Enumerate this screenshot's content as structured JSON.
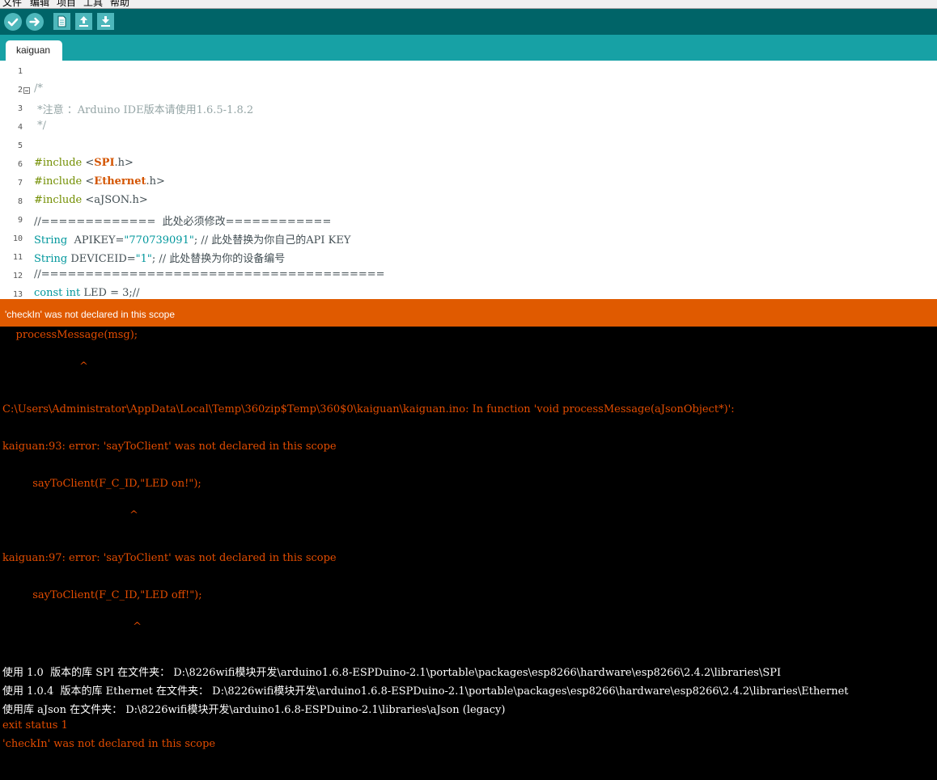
{
  "menubar": {
    "items": [
      "文件",
      "编辑",
      "项目",
      "工具",
      "帮助"
    ]
  },
  "toolbar": {
    "buttons": [
      "verify-icon",
      "upload-icon",
      "new-icon",
      "open-icon",
      "save-icon"
    ]
  },
  "tab": {
    "label": "kaiguan"
  },
  "editor": {
    "line_numbers": [
      "1",
      "2",
      "3",
      "4",
      "5",
      "6",
      "7",
      "8",
      "9",
      "10",
      "11",
      "12",
      "13"
    ],
    "lines": {
      "l2": "/*",
      "l3": " *注意 ：Arduino IDE版本请使用1.6.5-1.8.2",
      "l4": " */",
      "l6_pre": "#include ",
      "l6_a": "<",
      "l6_lib": "SPI",
      "l6_b": ".h>",
      "l7_pre": "#include ",
      "l7_a": "<",
      "l7_lib": "Ethernet",
      "l7_b": ".h>",
      "l8_pre": "#include ",
      "l8_rest": "<aJSON.h>",
      "l9": "//=============  此处必须修改============",
      "l10_type": "String",
      "l10_a": "  APIKEY=",
      "l10_str": "\"770739091\"",
      "l10_b": "; // 此处替换为你自己的API KEY",
      "l11_type": "String",
      "l11_a": " DEVICEID=",
      "l11_str": "\"1\"",
      "l11_b": "; // 此处替换为你的设备编号",
      "l12": "//=======================================",
      "l13_type": "const int",
      "l13_rest": " LED = 3;//"
    }
  },
  "status": {
    "message": "'checkIn' was not declared in this scope"
  },
  "console": {
    "lines": [
      "    processMessage(msg);",
      "                       ^",
      "C:\\Users\\Administrator\\AppData\\Local\\Temp\\360zip$Temp\\360$0\\kaiguan\\kaiguan.ino: In function 'void processMessage(aJsonObject*)':",
      "kaiguan:93: error: 'sayToClient' was not declared in this scope",
      "         sayToClient(F_C_ID,\"LED on!\");",
      "                                      ^",
      "kaiguan:97: error: 'sayToClient' was not declared in this scope",
      "         sayToClient(F_C_ID,\"LED off!\");",
      "                                       ^",
      "使用 1.0  版本的库 SPI 在文件夹： D:\\8226wifi模块开发\\arduino1.6.8-ESPDuino-2.1\\portable\\packages\\esp8266\\hardware\\esp8266\\2.4.2\\libraries\\SPI",
      "使用 1.0.4  版本的库 Ethernet 在文件夹： D:\\8226wifi模块开发\\arduino1.6.8-ESPDuino-2.1\\portable\\packages\\esp8266\\hardware\\esp8266\\2.4.2\\libraries\\Ethernet",
      "使用库 aJson 在文件夹： D:\\8226wifi模块开发\\arduino1.6.8-ESPDuino-2.1\\libraries\\aJson (legacy)",
      "exit status 1",
      "'checkIn' was not declared in this scope"
    ]
  },
  "colors": {
    "toolbar": "#006468",
    "tabbar": "#17a1a5",
    "status": "#e05a00",
    "console_error": "#e34c00"
  }
}
